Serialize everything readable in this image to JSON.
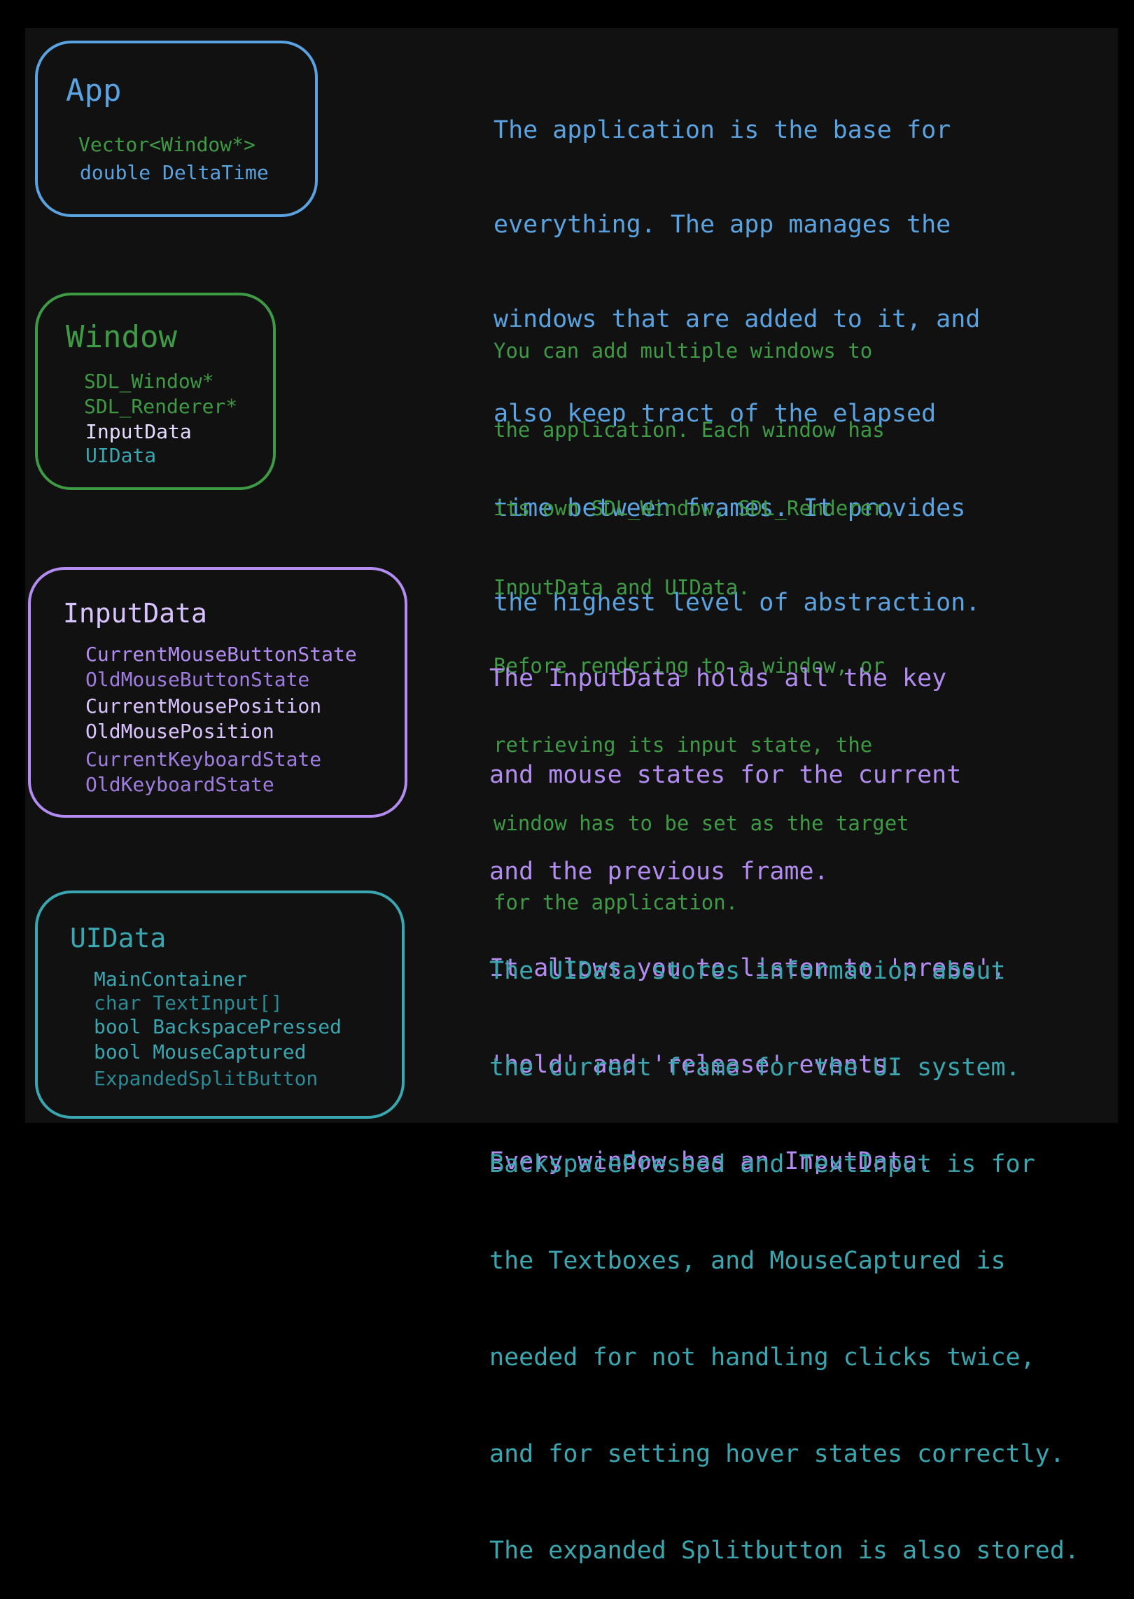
{
  "colors": {
    "background": "#111111",
    "outer": "#000000",
    "app": "#5aa2e0",
    "window": "#3f9a45",
    "input": "#b28cf0",
    "input_light": "#d9c3ff",
    "input_mid": "#9f7de0",
    "ui": "#3aa6b0",
    "ui_dark": "#2c8a95",
    "white_ish": "#e6dcff"
  },
  "app": {
    "title": "App",
    "fields": [
      "Vector<Window*>",
      "double DeltaTime"
    ],
    "description": [
      "The application is the base for",
      "everything. The app manages the",
      "windows that are added to it, and",
      "also keep tract of the elapsed",
      "time between frames. It provides",
      "the highest level of abstraction."
    ]
  },
  "window": {
    "title": "Window",
    "fields": [
      "SDL_Window*",
      "SDL_Renderer*",
      "InputData",
      "UIData"
    ],
    "description": [
      "You can add multiple windows to",
      "the application. Each window has",
      "its own SDL_Window, SDL_Renderer,",
      "InputData and UIData.",
      "Before rendering to a window, or",
      "retrieving its input state, the",
      "window has to be set as the target",
      "for the application."
    ]
  },
  "input": {
    "title": "InputData",
    "fields": [
      "CurrentMouseButtonState",
      "OldMouseButtonState",
      "CurrentMousePosition",
      "OldMousePosition",
      "CurrentKeyboardState",
      "OldKeyboardState"
    ],
    "description": [
      "The InputData holds all the key",
      "and mouse states for the current",
      "and the previous frame.",
      "It allows you to listen to 'press',",
      "'hold' and 'release' events.",
      "Every window has an InputData."
    ]
  },
  "ui": {
    "title": "UIData",
    "fields": [
      "MainContainer",
      "char TextInput[]",
      "bool BackspacePressed",
      "bool MouseCaptured",
      "ExpandedSplitButton"
    ],
    "description": [
      "The UIData stores information about",
      "the current frame for the UI system.",
      "BackspacePressed and TextInput is for",
      "the Textboxes, and MouseCaptured is",
      "needed for not handling clicks twice,",
      "and for setting hover states correctly.",
      "The expanded Splitbutton is also stored."
    ]
  }
}
